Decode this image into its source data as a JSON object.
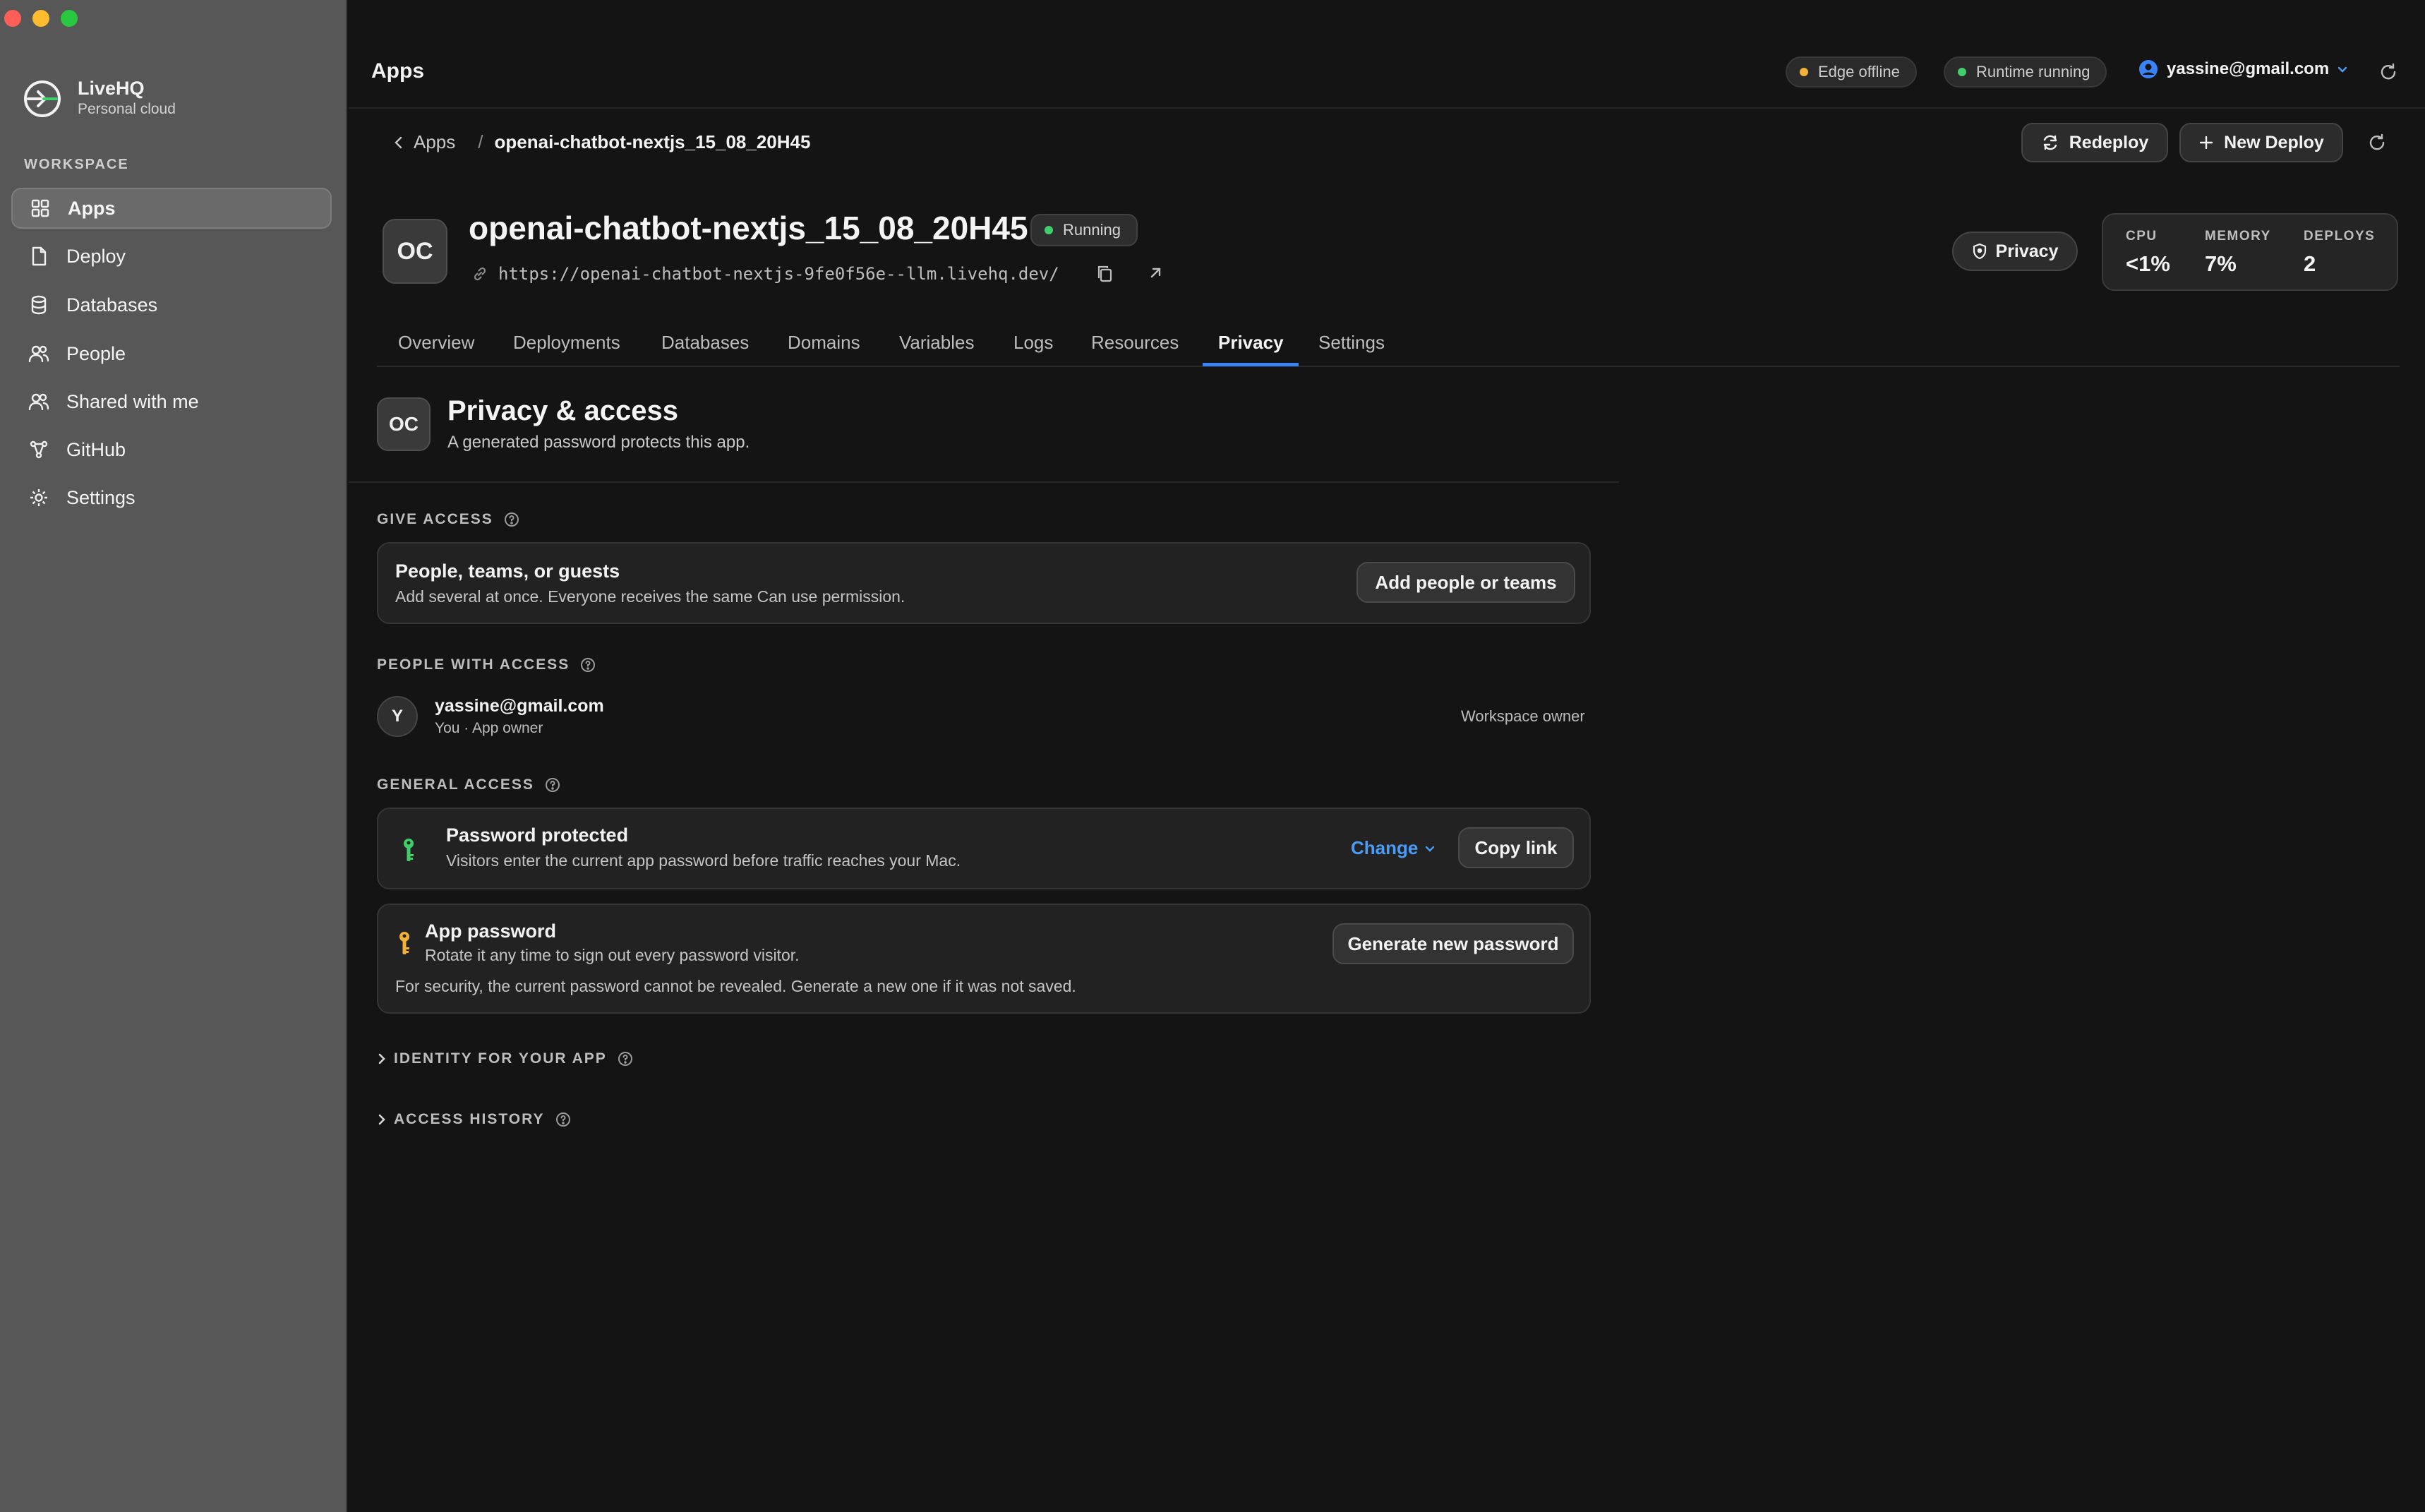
{
  "window": {
    "traffic_lights": [
      "#ff5f57",
      "#febc2e",
      "#28c840"
    ]
  },
  "brand": {
    "name": "LiveHQ",
    "subtitle": "Personal cloud"
  },
  "sidebar": {
    "section_label": "WORKSPACE",
    "items": [
      {
        "label": "Apps",
        "icon": "grid-icon",
        "active": true
      },
      {
        "label": "Deploy",
        "icon": "file-icon",
        "active": false
      },
      {
        "label": "Databases",
        "icon": "database-icon",
        "active": false
      },
      {
        "label": "People",
        "icon": "people-icon",
        "active": false
      },
      {
        "label": "Shared with me",
        "icon": "shared-people-icon",
        "active": false
      },
      {
        "label": "GitHub",
        "icon": "git-branch-icon",
        "active": false
      },
      {
        "label": "Settings",
        "icon": "gear-icon",
        "active": false
      }
    ]
  },
  "topbar": {
    "title": "Apps",
    "edge_status": "Edge offline",
    "edge_color": "#f2b138",
    "runtime_status": "Runtime running",
    "runtime_color": "#3ecf6a",
    "user_email": "yassine@gmail.com"
  },
  "breadcrumb": {
    "parent": "Apps",
    "separator": "/",
    "current": "openai-chatbot-nextjs_15_08_20H45"
  },
  "actions": {
    "redeploy": "Redeploy",
    "new_deploy": "New Deploy"
  },
  "app": {
    "initials": "OC",
    "name": "openai-chatbot-nextjs_15_08_20H45",
    "status": "Running",
    "status_color": "#3ecf6a",
    "url": "https://openai-chatbot-nextjs-9fe0f56e--llm.livehq.dev/",
    "privacy_button": "Privacy",
    "stats": {
      "cpu_label": "CPU",
      "cpu_value": "<1%",
      "memory_label": "MEMORY",
      "memory_value": "7%",
      "deploys_label": "DEPLOYS",
      "deploys_value": "2"
    }
  },
  "tabs": [
    "Overview",
    "Deployments",
    "Databases",
    "Domains",
    "Variables",
    "Logs",
    "Resources",
    "Privacy",
    "Settings"
  ],
  "active_tab": "Privacy",
  "privacy": {
    "initials": "OC",
    "title": "Privacy & access",
    "subtitle": "A generated password protects this app.",
    "give_access_label": "GIVE ACCESS",
    "give_access_title": "People, teams, or guests",
    "give_access_sub": "Add several at once. Everyone receives the same Can use permission.",
    "add_button": "Add people or teams",
    "people_label": "PEOPLE WITH ACCESS",
    "person": {
      "initial": "Y",
      "email": "yassine@gmail.com",
      "role_sub": "You · App owner",
      "role": "Workspace owner"
    },
    "general_label": "GENERAL ACCESS",
    "general_title": "Password protected",
    "general_sub": "Visitors enter the current app password before traffic reaches your Mac.",
    "change_label": "Change",
    "copy_link": "Copy link",
    "password_title": "App password",
    "password_sub": "Rotate it any time to sign out every password visitor.",
    "password_note": "For security, the current password cannot be revealed. Generate a new one if it was not saved.",
    "generate_button": "Generate new password",
    "identity_label": "IDENTITY FOR YOUR APP",
    "history_label": "ACCESS HISTORY",
    "accent_color": "#4a9cf5",
    "key_green": "#3ecf6a",
    "key_yellow": "#f2b138"
  }
}
